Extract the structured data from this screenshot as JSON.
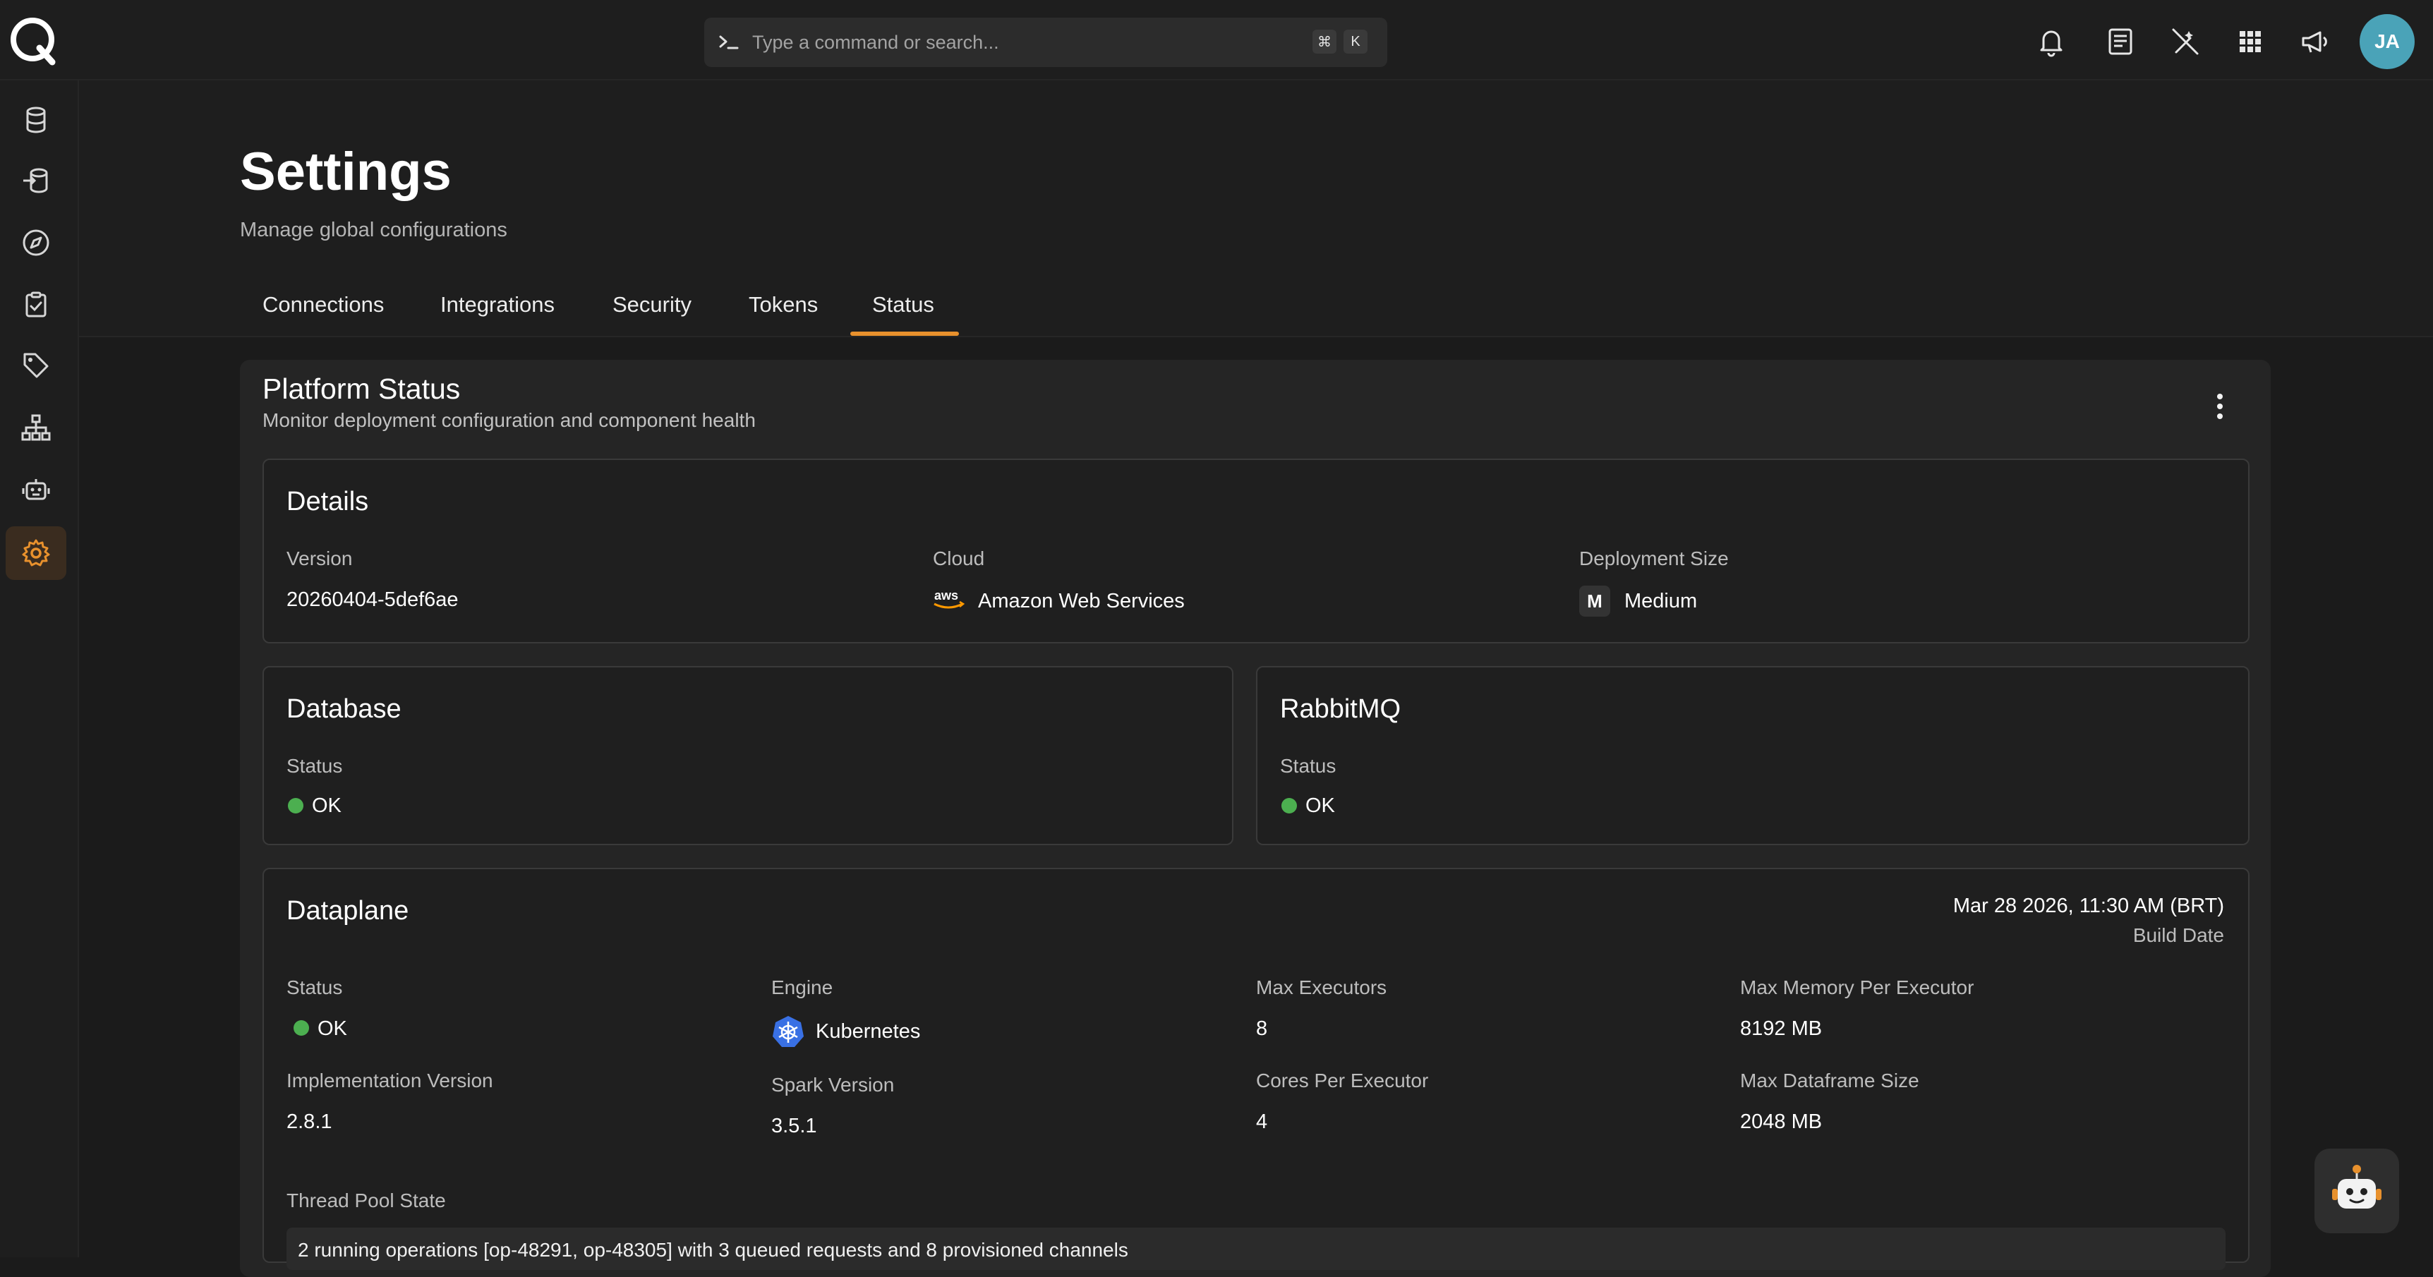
{
  "search": {
    "placeholder": "Type a command or search...",
    "kbd_cmd": "⌘",
    "kbd_k": "K"
  },
  "user": {
    "initials": "JA"
  },
  "colors": {
    "accent": "#e8912d",
    "ok": "#4caf50",
    "avatar": "#4aa3b8"
  },
  "header": {
    "title": "Settings",
    "subtitle": "Manage global configurations"
  },
  "tabs": [
    {
      "label": "Connections"
    },
    {
      "label": "Integrations"
    },
    {
      "label": "Security"
    },
    {
      "label": "Tokens"
    },
    {
      "label": "Status",
      "active": true
    }
  ],
  "platform": {
    "title": "Platform Status",
    "subtitle": "Monitor deployment configuration and component health"
  },
  "details": {
    "title": "Details",
    "version_label": "Version",
    "version_value": "20260404-5def6ae",
    "cloud_label": "Cloud",
    "cloud_value": "Amazon Web Services",
    "cloud_logo": "aws",
    "size_label": "Deployment Size",
    "size_value": "Medium",
    "size_badge": "M"
  },
  "database": {
    "title": "Database",
    "status_label": "Status",
    "status_value": "OK"
  },
  "rabbitmq": {
    "title": "RabbitMQ",
    "status_label": "Status",
    "status_value": "OK"
  },
  "dataplane": {
    "title": "Dataplane",
    "build_date": "Mar 28 2026, 11:30 AM (BRT)",
    "build_date_label": "Build Date",
    "status_label": "Status",
    "status_value": "OK",
    "engine_label": "Engine",
    "engine_value": "Kubernetes",
    "max_exec_label": "Max Executors",
    "max_exec_value": "8",
    "max_mem_label": "Max Memory Per Executor",
    "max_mem_value": "8192 MB",
    "impl_label": "Implementation Version",
    "impl_value": "2.8.1",
    "spark_label": "Spark Version",
    "spark_value": "3.5.1",
    "cores_label": "Cores Per Executor",
    "cores_value": "4",
    "max_df_label": "Max Dataframe Size",
    "max_df_value": "2048 MB",
    "thread_label": "Thread Pool State",
    "thread_value": "2 running operations [op-48291, op-48305] with 3 queued requests and 8 provisioned channels"
  }
}
